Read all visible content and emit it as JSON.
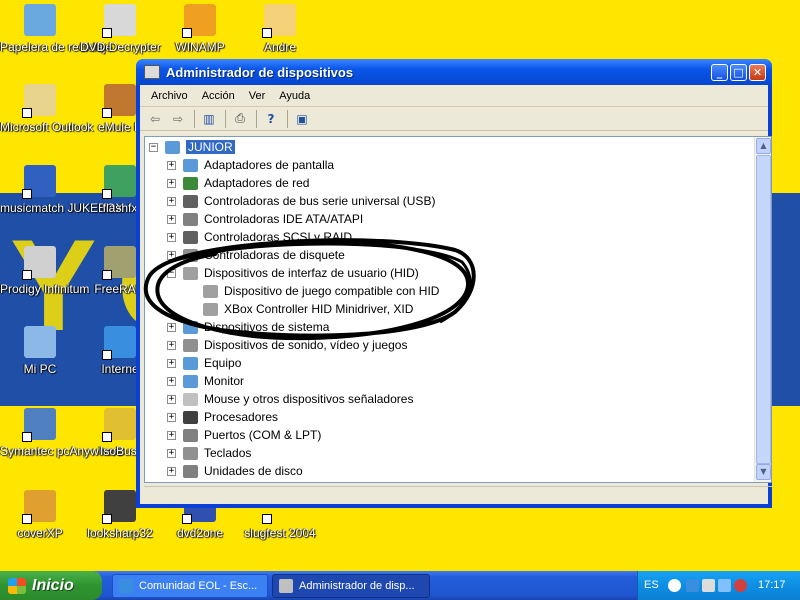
{
  "wallpaper": {
    "brand_text": "YC"
  },
  "desktop_icons": [
    {
      "label": "Papelera de reciclaje",
      "icon": "recycle-bin-icon",
      "color": "#6aa8e0"
    },
    {
      "label": "DVD Decrypter",
      "icon": "dvd-icon",
      "color": "#d8d8d8"
    },
    {
      "label": "WINAMP",
      "icon": "winamp-icon",
      "color": "#f0a020"
    },
    {
      "label": "Andre",
      "icon": "folder-icon",
      "color": "#f5d27a"
    },
    {
      "label": "Microsoft Outlook",
      "icon": "outlook-icon",
      "color": "#e8d48c"
    },
    {
      "label": "eMule P",
      "icon": "emule-icon",
      "color": "#c07830"
    },
    {
      "label": "musicmatch JUKEBOX",
      "icon": "musicmatch-icon",
      "color": "#3060c0"
    },
    {
      "label": "flashfx",
      "icon": "flashfxp-icon",
      "color": "#40a060"
    },
    {
      "label": "Prodigy Infinitum",
      "icon": "prodigy-icon",
      "color": "#d0d0d0"
    },
    {
      "label": "FreeRAM",
      "icon": "freeram-icon",
      "color": "#a0a070"
    },
    {
      "label": "Mi PC",
      "icon": "my-computer-icon",
      "color": "#8cb8e8"
    },
    {
      "label": "Interne",
      "icon": "internet-explorer-icon",
      "color": "#3a8ee0"
    },
    {
      "label": "Symantec pcAnywhere",
      "icon": "pcanywhere-icon",
      "color": "#5080c0"
    },
    {
      "label": "IsoBust",
      "icon": "isobuster-icon",
      "color": "#e0c030"
    },
    {
      "label": "coverXP",
      "icon": "coverxp-icon",
      "color": "#e0a030"
    },
    {
      "label": "looksharp32",
      "icon": "looksharp-icon",
      "color": "#404040"
    },
    {
      "label": "dvd2one",
      "icon": "dvd2one-icon",
      "color": "#3050b0"
    },
    {
      "label": "slugfest 2004",
      "icon": "slugfest-icon",
      "color": "#ffe600"
    }
  ],
  "window": {
    "title": "Administrador de dispositivos",
    "menu": [
      "Archivo",
      "Acción",
      "Ver",
      "Ayuda"
    ],
    "toolbar": [
      {
        "icon": "back-arrow-icon",
        "glyph": "⇦"
      },
      {
        "icon": "forward-arrow-icon",
        "glyph": "⇨"
      },
      {
        "icon": "properties-icon",
        "glyph": "▥"
      },
      {
        "icon": "print-icon",
        "glyph": "⎙"
      },
      {
        "icon": "help-icon",
        "glyph": "?"
      },
      {
        "icon": "scan-hardware-icon",
        "glyph": "▣"
      }
    ],
    "tree": {
      "root": "JUNIOR",
      "items": [
        {
          "label": "Adaptadores de pantalla",
          "icon": "display-adapter-icon",
          "color": "#5a9ad8",
          "expanded": false
        },
        {
          "label": "Adaptadores de red",
          "icon": "network-adapter-icon",
          "color": "#3a8a3a",
          "expanded": false
        },
        {
          "label": "Controladoras de bus serie universal (USB)",
          "icon": "usb-icon",
          "color": "#606060",
          "expanded": false
        },
        {
          "label": "Controladoras IDE ATA/ATAPI",
          "icon": "ide-controller-icon",
          "color": "#808080",
          "expanded": false
        },
        {
          "label": "Controladoras SCSI y RAID",
          "icon": "scsi-controller-icon",
          "color": "#606060",
          "expanded": false
        },
        {
          "label": "Controladoras de disquete",
          "icon": "floppy-controller-icon",
          "color": "#909090",
          "expanded": false
        },
        {
          "label": "Dispositivos de interfaz de usuario (HID)",
          "icon": "hid-icon",
          "color": "#a0a0a0",
          "expanded": true,
          "children": [
            {
              "label": "Dispositivo de juego  compatible con HID",
              "icon": "hid-device-icon",
              "color": "#a0a0a0"
            },
            {
              "label": "XBox Controller HID Minidriver, XID",
              "icon": "hid-device-icon",
              "color": "#a0a0a0"
            }
          ]
        },
        {
          "label": "Dispositivos de sistema",
          "icon": "system-devices-icon",
          "color": "#5a9ad8",
          "expanded": false
        },
        {
          "label": "Dispositivos de sonido, vídeo y juegos",
          "icon": "sound-icon",
          "color": "#909090",
          "expanded": false
        },
        {
          "label": "Equipo",
          "icon": "computer-icon",
          "color": "#5a9ad8",
          "expanded": false
        },
        {
          "label": "Monitor",
          "icon": "monitor-icon",
          "color": "#5a9ad8",
          "expanded": false
        },
        {
          "label": "Mouse y otros dispositivos señaladores",
          "icon": "mouse-icon",
          "color": "#c0c0c0",
          "expanded": false
        },
        {
          "label": "Procesadores",
          "icon": "processor-icon",
          "color": "#404040",
          "expanded": false
        },
        {
          "label": "Puertos (COM & LPT)",
          "icon": "port-icon",
          "color": "#808080",
          "expanded": false
        },
        {
          "label": "Teclados",
          "icon": "keyboard-icon",
          "color": "#909090",
          "expanded": false
        },
        {
          "label": "Unidades de disco",
          "icon": "disk-drive-icon",
          "color": "#808080",
          "expanded": false
        }
      ]
    }
  },
  "taskbar": {
    "start_label": "Inicio",
    "tasks": [
      {
        "label": "Comunidad EOL - Esc...",
        "icon": "ie-icon",
        "color": "#3a8ee0",
        "active": false
      },
      {
        "label": "Administrador de disp...",
        "icon": "device-manager-icon",
        "color": "#c0c0c0",
        "active": true
      }
    ],
    "tray": {
      "language": "ES",
      "clock": "17:17"
    }
  }
}
